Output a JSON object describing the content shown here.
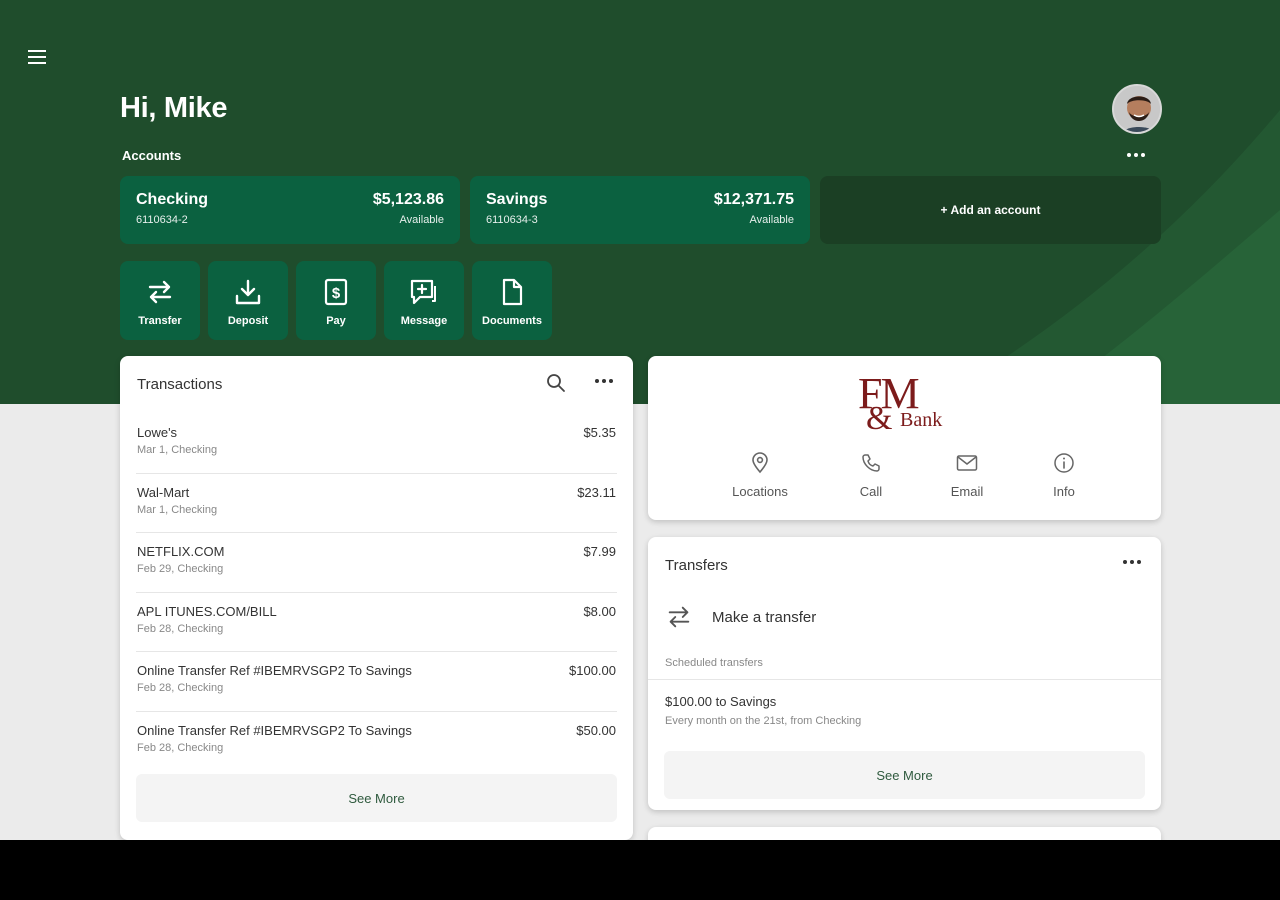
{
  "header": {
    "greeting": "Hi, Mike",
    "accounts_label": "Accounts",
    "add_account_label": "+ Add an account"
  },
  "accounts": [
    {
      "name": "Checking",
      "number": "6110634-2",
      "balance": "$5,123.86",
      "balance_label": "Available"
    },
    {
      "name": "Savings",
      "number": "6110634-3",
      "balance": "$12,371.75",
      "balance_label": "Available"
    }
  ],
  "actions": [
    {
      "label": "Transfer",
      "icon": "transfer-icon"
    },
    {
      "label": "Deposit",
      "icon": "deposit-icon"
    },
    {
      "label": "Pay",
      "icon": "pay-icon"
    },
    {
      "label": "Message",
      "icon": "message-icon"
    },
    {
      "label": "Documents",
      "icon": "documents-icon"
    }
  ],
  "transactions": {
    "title": "Transactions",
    "items": [
      {
        "description": "Lowe's",
        "meta": "Mar 1, Checking",
        "amount": "$5.35"
      },
      {
        "description": "Wal-Mart",
        "meta": "Mar 1, Checking",
        "amount": "$23.11"
      },
      {
        "description": "NETFLIX.COM",
        "meta": "Feb 29, Checking",
        "amount": "$7.99"
      },
      {
        "description": "APL ITUNES.COM/BILL",
        "meta": "Feb 28, Checking",
        "amount": "$8.00"
      },
      {
        "description": "Online Transfer Ref #IBEMRVSGP2 To Savings",
        "meta": "Feb 28, Checking",
        "amount": "$100.00"
      },
      {
        "description": "Online Transfer Ref #IBEMRVSGP2 To Savings",
        "meta": "Feb 28, Checking",
        "amount": "$50.00"
      }
    ],
    "see_more": "See More"
  },
  "bank": {
    "logo_text_top": "FM",
    "logo_text_amp": "&",
    "logo_text_bank": "Bank",
    "links": [
      {
        "label": "Locations",
        "icon": "location-pin-icon"
      },
      {
        "label": "Call",
        "icon": "phone-icon"
      },
      {
        "label": "Email",
        "icon": "email-icon"
      },
      {
        "label": "Info",
        "icon": "info-icon"
      }
    ]
  },
  "transfers": {
    "title": "Transfers",
    "make_transfer": "Make a transfer",
    "scheduled_label": "Scheduled transfers",
    "scheduled": [
      {
        "title": "$100.00 to Savings",
        "detail": "Every month on the 21st, from Checking"
      }
    ],
    "see_more": "See More"
  },
  "colors": {
    "hero": "#1f4d2c",
    "account_tile": "#0b6140",
    "add_account_tile": "#1b3f24",
    "logo": "#7c1b1b"
  }
}
